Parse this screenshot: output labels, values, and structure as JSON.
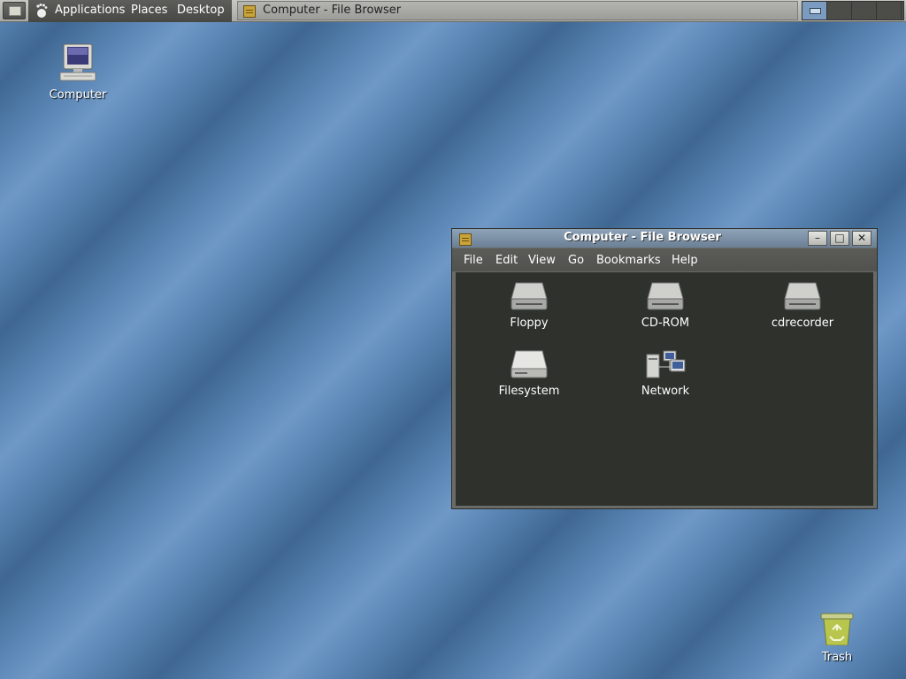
{
  "panel": {
    "menus": [
      "Applications",
      "Places",
      "Desktop"
    ],
    "task_window_title": "Computer - File Browser"
  },
  "desktop": {
    "computer_label": "Computer",
    "trash_label": "Trash"
  },
  "window": {
    "title": "Computer - File Browser",
    "menu": [
      "File",
      "Edit",
      "View",
      "Go",
      "Bookmarks",
      "Help"
    ],
    "items": [
      {
        "label": "Floppy",
        "icon": "drive-icon"
      },
      {
        "label": "CD-ROM",
        "icon": "drive-icon"
      },
      {
        "label": "cdrecorder",
        "icon": "drive-icon"
      },
      {
        "label": "Filesystem",
        "icon": "harddisk-icon"
      },
      {
        "label": "Network",
        "icon": "network-icon"
      }
    ]
  },
  "colors": {
    "desktop_stripe_dark": "#3f6792",
    "desktop_stripe_light": "#6f98c6",
    "content_bg": "#2f312d"
  }
}
